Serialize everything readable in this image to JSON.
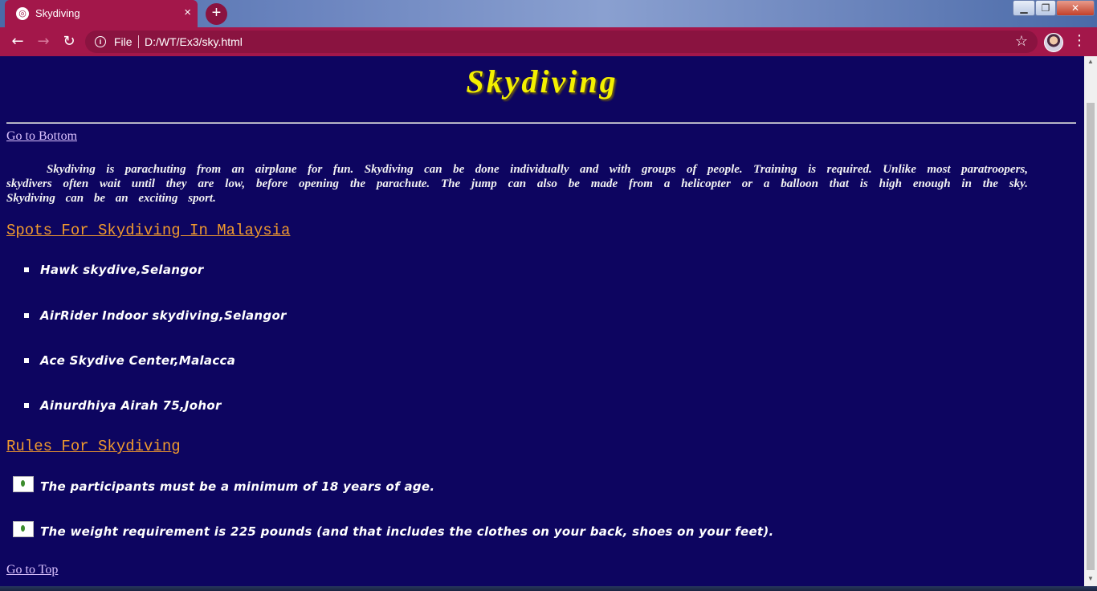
{
  "browser": {
    "tab_title": "Skydiving",
    "tab_close": "×",
    "new_tab": "+",
    "file_label": "File",
    "url": "D:/WT/Ex3/sky.html",
    "window_controls": [
      "minimize",
      "maximize",
      "close"
    ],
    "colors": {
      "chrome": "#a3174a",
      "omnibox": "#8a1340"
    }
  },
  "page": {
    "heading": "Skydiving",
    "go_bottom": "Go to Bottom",
    "paragraph": "Skydiving is parachuting from an airplane for fun. Skydiving can be done individually and with groups of people. Training is required. Unlike most paratroopers, skydivers often wait until they are low, before opening the parachute. The jump can also be made from a helicopter or a balloon that is high enough in the sky. Skydiving can be an exciting sport.",
    "spots_heading": "Spots For Skydiving In Malaysia",
    "spots": [
      "Hawk skydive,Selangor",
      "AirRider Indoor skydiving,Selangor",
      "Ace Skydive Center,Malacca",
      "Ainurdhiya Airah 75,Johor"
    ],
    "rules_heading": "Rules For Skydiving",
    "rules": [
      "The participants must be a minimum of 18 years of age.",
      "The weight requirement is 225 pounds (and that includes the clothes on your back, shoes on your feet)."
    ],
    "go_top": "Go to Top",
    "colors": {
      "background": "#0d0560",
      "heading": "#f4f000",
      "section": "#f09a2e",
      "link": "#dcc3ff",
      "text": "#ffffff"
    }
  }
}
